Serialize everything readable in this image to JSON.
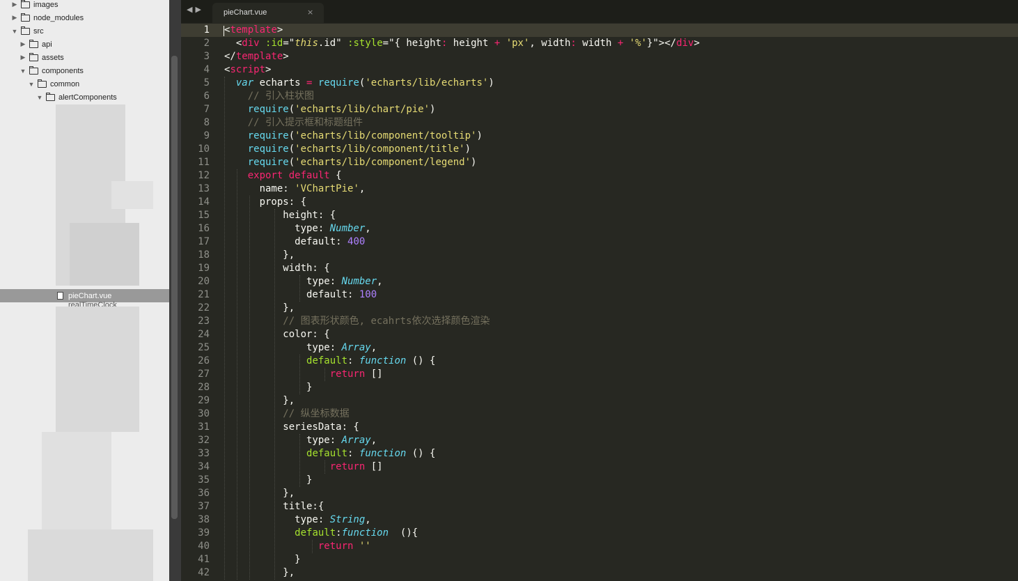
{
  "sidebar": {
    "items": [
      {
        "label": "images",
        "expanded": false
      },
      {
        "label": "node_modules",
        "expanded": false
      },
      {
        "label": "src",
        "expanded": true
      },
      {
        "label": "api",
        "expanded": false
      },
      {
        "label": "assets",
        "expanded": false
      },
      {
        "label": "components",
        "expanded": true
      },
      {
        "label": "common",
        "expanded": true
      },
      {
        "label": "alertComponents",
        "expanded": true
      }
    ],
    "selected_file": "pieChart.vue",
    "partial_file": "realTimeClock"
  },
  "tab": {
    "title": "pieChart.vue",
    "close": "×"
  },
  "nav": {
    "back": "◀",
    "forward": "▶"
  },
  "editor": {
    "active_line": 1,
    "line_numbers": [
      "1",
      "2",
      "3",
      "4",
      "5",
      "6",
      "7",
      "8",
      "9",
      "10",
      "11",
      "12",
      "13",
      "14",
      "15",
      "16",
      "17",
      "18",
      "19",
      "20",
      "21",
      "22",
      "23",
      "24",
      "25",
      "26",
      "27",
      "28",
      "29",
      "30",
      "31",
      "32",
      "33",
      "34",
      "35",
      "36",
      "37",
      "38",
      "39",
      "40",
      "41",
      "42"
    ],
    "lines": [
      [
        {
          "c": "p",
          "t": "<"
        },
        {
          "c": "tg",
          "t": "template"
        },
        {
          "c": "p",
          "t": ">"
        }
      ],
      [
        {
          "c": "p",
          "t": "  <"
        },
        {
          "c": "tg",
          "t": "div"
        },
        {
          "c": "p",
          "t": " "
        },
        {
          "c": "at",
          "t": ":id"
        },
        {
          "c": "p",
          "t": "=\""
        },
        {
          "c": "st it",
          "t": "this"
        },
        {
          "c": "p",
          "t": ".id\" "
        },
        {
          "c": "at",
          "t": ":style"
        },
        {
          "c": "p",
          "t": "=\"{ height"
        },
        {
          "c": "op",
          "t": ":"
        },
        {
          "c": "p",
          "t": " height "
        },
        {
          "c": "op",
          "t": "+"
        },
        {
          "c": "p",
          "t": " "
        },
        {
          "c": "st",
          "t": "'px'"
        },
        {
          "c": "p",
          "t": ", width"
        },
        {
          "c": "op",
          "t": ":"
        },
        {
          "c": "p",
          "t": " width "
        },
        {
          "c": "op",
          "t": "+"
        },
        {
          "c": "p",
          "t": " "
        },
        {
          "c": "st",
          "t": "'%'"
        },
        {
          "c": "p",
          "t": "}\"></"
        },
        {
          "c": "tg",
          "t": "div"
        },
        {
          "c": "p",
          "t": ">"
        }
      ],
      [
        {
          "c": "p",
          "t": "</"
        },
        {
          "c": "tg",
          "t": "template"
        },
        {
          "c": "p",
          "t": ">"
        }
      ],
      [
        {
          "c": "p",
          "t": "<"
        },
        {
          "c": "tg",
          "t": "script"
        },
        {
          "c": "p",
          "t": ">"
        }
      ],
      [
        {
          "c": "p",
          "t": "  "
        },
        {
          "c": "ty",
          "t": "var"
        },
        {
          "c": "p",
          "t": " echarts "
        },
        {
          "c": "op",
          "t": "="
        },
        {
          "c": "p",
          "t": " "
        },
        {
          "c": "fn",
          "t": "require"
        },
        {
          "c": "p",
          "t": "("
        },
        {
          "c": "st",
          "t": "'echarts/lib/echarts'"
        },
        {
          "c": "p",
          "t": ")"
        }
      ],
      [
        {
          "c": "p",
          "t": "    "
        },
        {
          "c": "cm",
          "t": "// 引入柱状图"
        }
      ],
      [
        {
          "c": "p",
          "t": "    "
        },
        {
          "c": "fn",
          "t": "require"
        },
        {
          "c": "p",
          "t": "("
        },
        {
          "c": "st",
          "t": "'echarts/lib/chart/pie'"
        },
        {
          "c": "p",
          "t": ")"
        }
      ],
      [
        {
          "c": "p",
          "t": "    "
        },
        {
          "c": "cm",
          "t": "// 引入提示框和标题组件"
        }
      ],
      [
        {
          "c": "p",
          "t": "    "
        },
        {
          "c": "fn",
          "t": "require"
        },
        {
          "c": "p",
          "t": "("
        },
        {
          "c": "st",
          "t": "'echarts/lib/component/tooltip'"
        },
        {
          "c": "p",
          "t": ")"
        }
      ],
      [
        {
          "c": "p",
          "t": "    "
        },
        {
          "c": "fn",
          "t": "require"
        },
        {
          "c": "p",
          "t": "("
        },
        {
          "c": "st",
          "t": "'echarts/lib/component/title'"
        },
        {
          "c": "p",
          "t": ")"
        }
      ],
      [
        {
          "c": "p",
          "t": "    "
        },
        {
          "c": "fn",
          "t": "require"
        },
        {
          "c": "p",
          "t": "("
        },
        {
          "c": "st",
          "t": "'echarts/lib/component/legend'"
        },
        {
          "c": "p",
          "t": ")"
        }
      ],
      [
        {
          "c": "p",
          "t": "    "
        },
        {
          "c": "kw",
          "t": "export"
        },
        {
          "c": "p",
          "t": " "
        },
        {
          "c": "kw",
          "t": "default"
        },
        {
          "c": "p",
          "t": " {"
        }
      ],
      [
        {
          "c": "p",
          "t": "      name: "
        },
        {
          "c": "st",
          "t": "'VChartPie'"
        },
        {
          "c": "p",
          "t": ","
        }
      ],
      [
        {
          "c": "p",
          "t": "      props: {"
        }
      ],
      [
        {
          "c": "p",
          "t": "          height: {"
        }
      ],
      [
        {
          "c": "p",
          "t": "            type: "
        },
        {
          "c": "ty",
          "t": "Number"
        },
        {
          "c": "p",
          "t": ","
        }
      ],
      [
        {
          "c": "p",
          "t": "            default: "
        },
        {
          "c": "nm",
          "t": "400"
        }
      ],
      [
        {
          "c": "p",
          "t": "          },"
        }
      ],
      [
        {
          "c": "p",
          "t": "          width: {"
        }
      ],
      [
        {
          "c": "p",
          "t": "              type: "
        },
        {
          "c": "ty",
          "t": "Number"
        },
        {
          "c": "p",
          "t": ","
        }
      ],
      [
        {
          "c": "p",
          "t": "              default: "
        },
        {
          "c": "nm",
          "t": "100"
        }
      ],
      [
        {
          "c": "p",
          "t": "          },"
        }
      ],
      [
        {
          "c": "p",
          "t": "          "
        },
        {
          "c": "cm",
          "t": "// 图表形状颜色, ecahrts依次选择颜色渲染"
        }
      ],
      [
        {
          "c": "p",
          "t": "          color: {"
        }
      ],
      [
        {
          "c": "p",
          "t": "              type: "
        },
        {
          "c": "ty",
          "t": "Array"
        },
        {
          "c": "p",
          "t": ","
        }
      ],
      [
        {
          "c": "p",
          "t": "              "
        },
        {
          "c": "at",
          "t": "default"
        },
        {
          "c": "p",
          "t": ": "
        },
        {
          "c": "ty",
          "t": "function"
        },
        {
          "c": "p",
          "t": " () {"
        }
      ],
      [
        {
          "c": "p",
          "t": "                  "
        },
        {
          "c": "kw",
          "t": "return"
        },
        {
          "c": "p",
          "t": " []"
        }
      ],
      [
        {
          "c": "p",
          "t": "              }"
        }
      ],
      [
        {
          "c": "p",
          "t": "          },"
        }
      ],
      [
        {
          "c": "p",
          "t": "          "
        },
        {
          "c": "cm",
          "t": "// 纵坐标数据"
        }
      ],
      [
        {
          "c": "p",
          "t": "          seriesData: {"
        }
      ],
      [
        {
          "c": "p",
          "t": "              type: "
        },
        {
          "c": "ty",
          "t": "Array"
        },
        {
          "c": "p",
          "t": ","
        }
      ],
      [
        {
          "c": "p",
          "t": "              "
        },
        {
          "c": "at",
          "t": "default"
        },
        {
          "c": "p",
          "t": ": "
        },
        {
          "c": "ty",
          "t": "function"
        },
        {
          "c": "p",
          "t": " () {"
        }
      ],
      [
        {
          "c": "p",
          "t": "                  "
        },
        {
          "c": "kw",
          "t": "return"
        },
        {
          "c": "p",
          "t": " []"
        }
      ],
      [
        {
          "c": "p",
          "t": "              }"
        }
      ],
      [
        {
          "c": "p",
          "t": "          },"
        }
      ],
      [
        {
          "c": "p",
          "t": "          title:{"
        }
      ],
      [
        {
          "c": "p",
          "t": "            type: "
        },
        {
          "c": "ty",
          "t": "String"
        },
        {
          "c": "p",
          "t": ","
        }
      ],
      [
        {
          "c": "p",
          "t": "            "
        },
        {
          "c": "at",
          "t": "default"
        },
        {
          "c": "p",
          "t": ":"
        },
        {
          "c": "ty",
          "t": "function"
        },
        {
          "c": "p",
          "t": "  (){"
        }
      ],
      [
        {
          "c": "p",
          "t": "                "
        },
        {
          "c": "kw",
          "t": "return"
        },
        {
          "c": "p",
          "t": " "
        },
        {
          "c": "st",
          "t": "''"
        }
      ],
      [
        {
          "c": "p",
          "t": "            }"
        }
      ],
      [
        {
          "c": "p",
          "t": "          },"
        }
      ]
    ]
  },
  "colors": {
    "background": "#272822",
    "sidebar": "#ececec",
    "tag": "#f92672",
    "string": "#e6db74",
    "number": "#ae81ff",
    "type": "#66d9ef",
    "comment": "#75715e"
  }
}
